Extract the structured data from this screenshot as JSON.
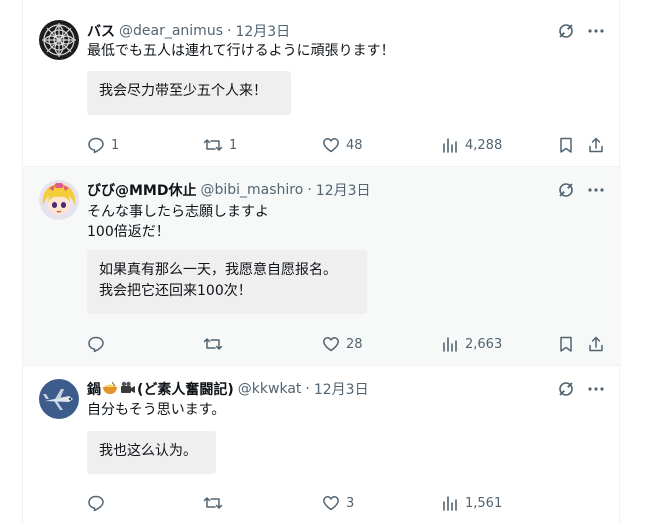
{
  "colors": {
    "muted": "#536471",
    "text": "#0f1419",
    "translation_bg": "#f0efef",
    "highlight_bg": "#f7f9f9"
  },
  "posts": [
    {
      "display_name": "バス",
      "handle": "@dear_animus",
      "separator": "·",
      "date": "12月3日",
      "text": "最低でも五人は連れて行けるように頑張ります！",
      "translation": "我会尽力带至少五个人来！",
      "stats": {
        "replies": "1",
        "reposts": "1",
        "likes": "48",
        "views": "4,288"
      },
      "icons": [
        "reply-icon",
        "repost-icon",
        "like-icon",
        "views-icon",
        "bookmark-icon",
        "share-icon"
      ]
    },
    {
      "display_name": "びび@MMD休止",
      "handle": "@bibi_mashiro",
      "separator": "·",
      "date": "12月3日",
      "text": "そんな事したら志願しますよ\n100倍返だ！",
      "translation": "如果真有那么一天，我愿意自愿报名。\n我会把它还回来100次！",
      "stats": {
        "replies": "",
        "reposts": "",
        "likes": "28",
        "views": "2,663"
      }
    },
    {
      "display_name_prefix": "鍋",
      "display_name_suffix": "(ど素人奮闘記)",
      "handle": "@kkwkat",
      "separator": "·",
      "date": "12月3日",
      "text": "自分もそう思います。",
      "translation": "我也这么认为。",
      "stats": {
        "replies": "",
        "reposts": "",
        "likes": "3",
        "views": "1,561"
      }
    }
  ]
}
